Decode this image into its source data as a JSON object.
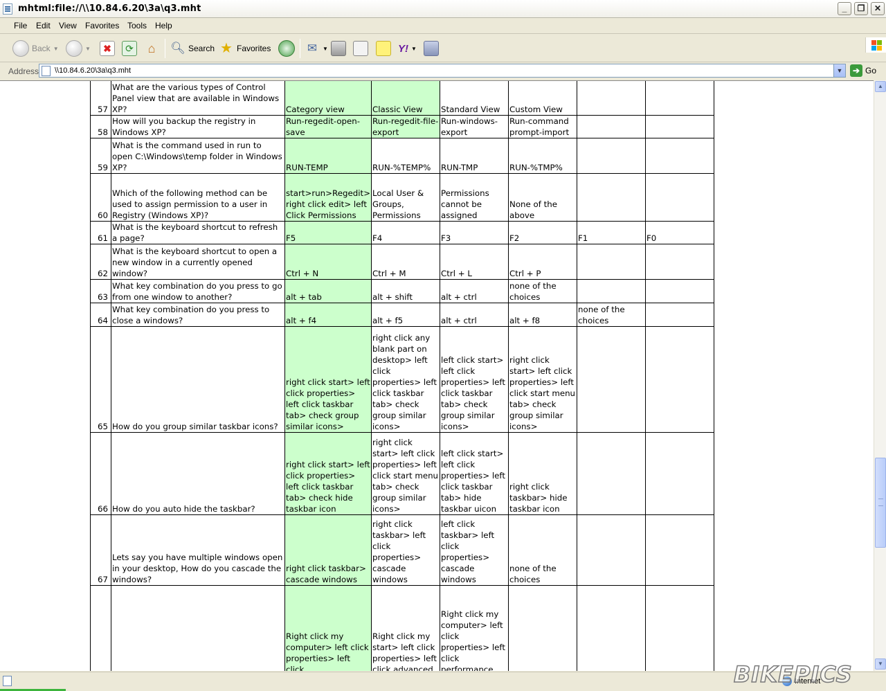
{
  "window": {
    "title": "mhtml:file://\\\\10.84.6.20\\3a\\q3.mht"
  },
  "menu": [
    "File",
    "Edit",
    "View",
    "Favorites",
    "Tools",
    "Help"
  ],
  "toolbar": {
    "back": "Back",
    "search": "Search",
    "favorites": "Favorites"
  },
  "address": {
    "label": "Address",
    "value": "\\\\10.84.6.20\\3a\\q3.mht",
    "go": "Go"
  },
  "colors": {
    "correct": "#ccffcc",
    "accent": "#3b9a3b"
  },
  "questions": [
    {
      "num": "57",
      "question": "What are the various types of Control Panel view that are available in Windows XP?",
      "answers": [
        "Category view",
        "Classic View",
        "Standard View",
        "Custom View",
        "",
        ""
      ],
      "correct": [
        0,
        1
      ]
    },
    {
      "num": "58",
      "question": "How will you backup the registry in Windows XP?",
      "answers": [
        "Run-regedit-open-save",
        "Run-regedit-file-export",
        "Run-windows-export",
        "Run-command prompt-import",
        "",
        ""
      ],
      "correct": [
        0,
        1
      ]
    },
    {
      "num": "59",
      "question": "What is the command used in run to open C:\\Windows\\temp folder in Windows XP?",
      "answers": [
        "RUN-TEMP",
        "RUN-%TEMP%",
        "RUN-TMP",
        "RUN-%TMP%",
        "",
        ""
      ],
      "correct": [
        0
      ]
    },
    {
      "num": "60",
      "question": "Which of the following method can be used to assign permission to a user in Registry (Windows XP)?",
      "answers": [
        "start>run>Regedit> right click edit> left Click Permissions",
        "Local User & Groups, Permissions",
        "Permissions cannot be assigned",
        "None of the above",
        "",
        ""
      ],
      "correct": [
        0
      ]
    },
    {
      "num": "61",
      "question": "What is the keyboard shortcut to refresh a page?",
      "answers": [
        "F5",
        "F4",
        "F3",
        "F2",
        "F1",
        "F0"
      ],
      "correct": [
        0
      ]
    },
    {
      "num": "62",
      "question": "What is the keyboard shortcut to open a new window in a currently opened window?",
      "answers": [
        "Ctrl + N",
        "Ctrl + M",
        "Ctrl + L",
        "Ctrl + P",
        "",
        ""
      ],
      "correct": [
        0
      ]
    },
    {
      "num": "63",
      "question": "What key combination do you press to go from one window to another?",
      "answers": [
        "alt + tab",
        "alt + shift",
        "alt + ctrl",
        "none of the choices",
        "",
        ""
      ],
      "correct": [
        0
      ]
    },
    {
      "num": "64",
      "question": "What key combination do you press to close a windows?",
      "answers": [
        "alt + f4",
        "alt + f5",
        "alt + ctrl",
        "alt + f8",
        "none of the choices",
        ""
      ],
      "correct": [
        0
      ]
    },
    {
      "num": "65",
      "question": "How do you group similar taskbar icons?",
      "answers": [
        "right click start> left click properties> left click taskbar tab> check group similar icons>",
        "right click any blank part on desktop> left click properties> left click taskbar tab> check group similar icons>",
        "left click start> left click properties> left click taskbar tab> check group similar icons>",
        "right click start> left click properties> left click start menu tab> check group similar icons>",
        "",
        ""
      ],
      "correct": [
        0
      ]
    },
    {
      "num": "66",
      "question": "How do you auto hide the taskbar?",
      "answers": [
        "right click start> left click properties> left click taskbar tab> check hide taskbar icon",
        "right click start> left click properties> left click start menu tab> check group similar icons>",
        "left click start> left click properties> left click taskbar tab> hide taskbar uicon",
        "right click taskbar> hide taskbar icon",
        "",
        ""
      ],
      "correct": [
        0
      ]
    },
    {
      "num": "67",
      "question": "Lets say you have multiple windows open in your desktop, How do you cascade the windows?",
      "answers": [
        "right click taskbar> cascade windows",
        "right click taskbar> left click properties> cascade windows",
        "left click taskbar> left click properties> cascade windows",
        "none of the choices",
        "",
        ""
      ],
      "correct": [
        0
      ]
    },
    {
      "num": "",
      "question": "",
      "answers": [
        "Right click my computer> left click properties> left click",
        "Right click my start> left click properties> left click advanced",
        "Right click my computer> left click properties> left click performance",
        "",
        "",
        ""
      ],
      "correct": [
        0
      ]
    }
  ],
  "status": {
    "zone": "Internet"
  },
  "watermark": "BIKEPICS"
}
